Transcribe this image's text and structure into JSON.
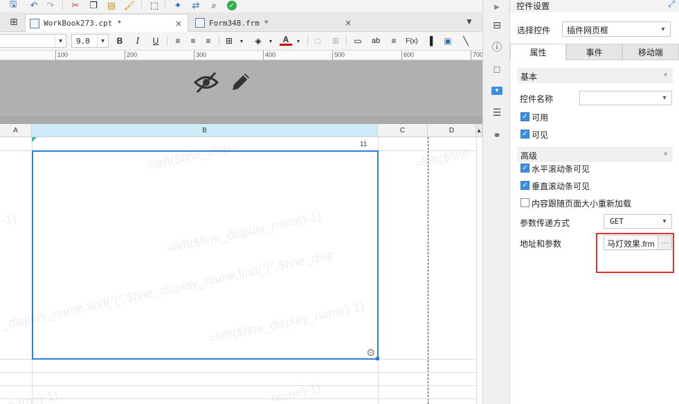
{
  "tabs": [
    {
      "label": "WorkBook273.cpt *",
      "close": "×"
    },
    {
      "label": "Form348.frm *",
      "close": "×"
    }
  ],
  "format_toolbar": {
    "font_size": "9.0",
    "bold": "B",
    "italic": "I",
    "underline": "U",
    "text_tool": "ab",
    "formula": "F(x)"
  },
  "ruler": {
    "labels": [
      "100",
      "200",
      "300",
      "400",
      "500",
      "600",
      "700"
    ]
  },
  "sheet": {
    "columns": [
      "A",
      "B",
      "C",
      "D"
    ],
    "cell_value": "11",
    "watermarks": [
      "=left($fine_disp",
      "=left($fine",
      "-1)",
      "=left($fine_display_name)-1)",
      "_display_name,find(\"(\",$fine_display_name,find(\"(\",$fine_disp",
      "=left($fine_display_name)-1)",
      "name)-1)",
      "_name)-1)"
    ]
  },
  "panel": {
    "title": "控件设置",
    "select_widget_label": "选择控件",
    "select_widget_value": "插件网页框",
    "tabs": [
      "属性",
      "事件",
      "移动端"
    ],
    "section_basic": "基本",
    "widget_name_label": "控件名称",
    "widget_name_value": "",
    "enabled_label": "可用",
    "visible_label": "可见",
    "section_advanced": "高级",
    "hscroll_label": "水平滚动条可见",
    "vscroll_label": "垂直滚动条可见",
    "reload_label": "内容跟随页面大小重新加载",
    "param_method_label": "参数传递方式",
    "param_method_value": "GET",
    "url_label": "地址和参数",
    "url_value": "马灯效果.frm",
    "url_button": "···"
  },
  "colors": {
    "accent": "#3d8ee0",
    "highlight_border": "#e03030",
    "selection": "#2f7fd6"
  }
}
